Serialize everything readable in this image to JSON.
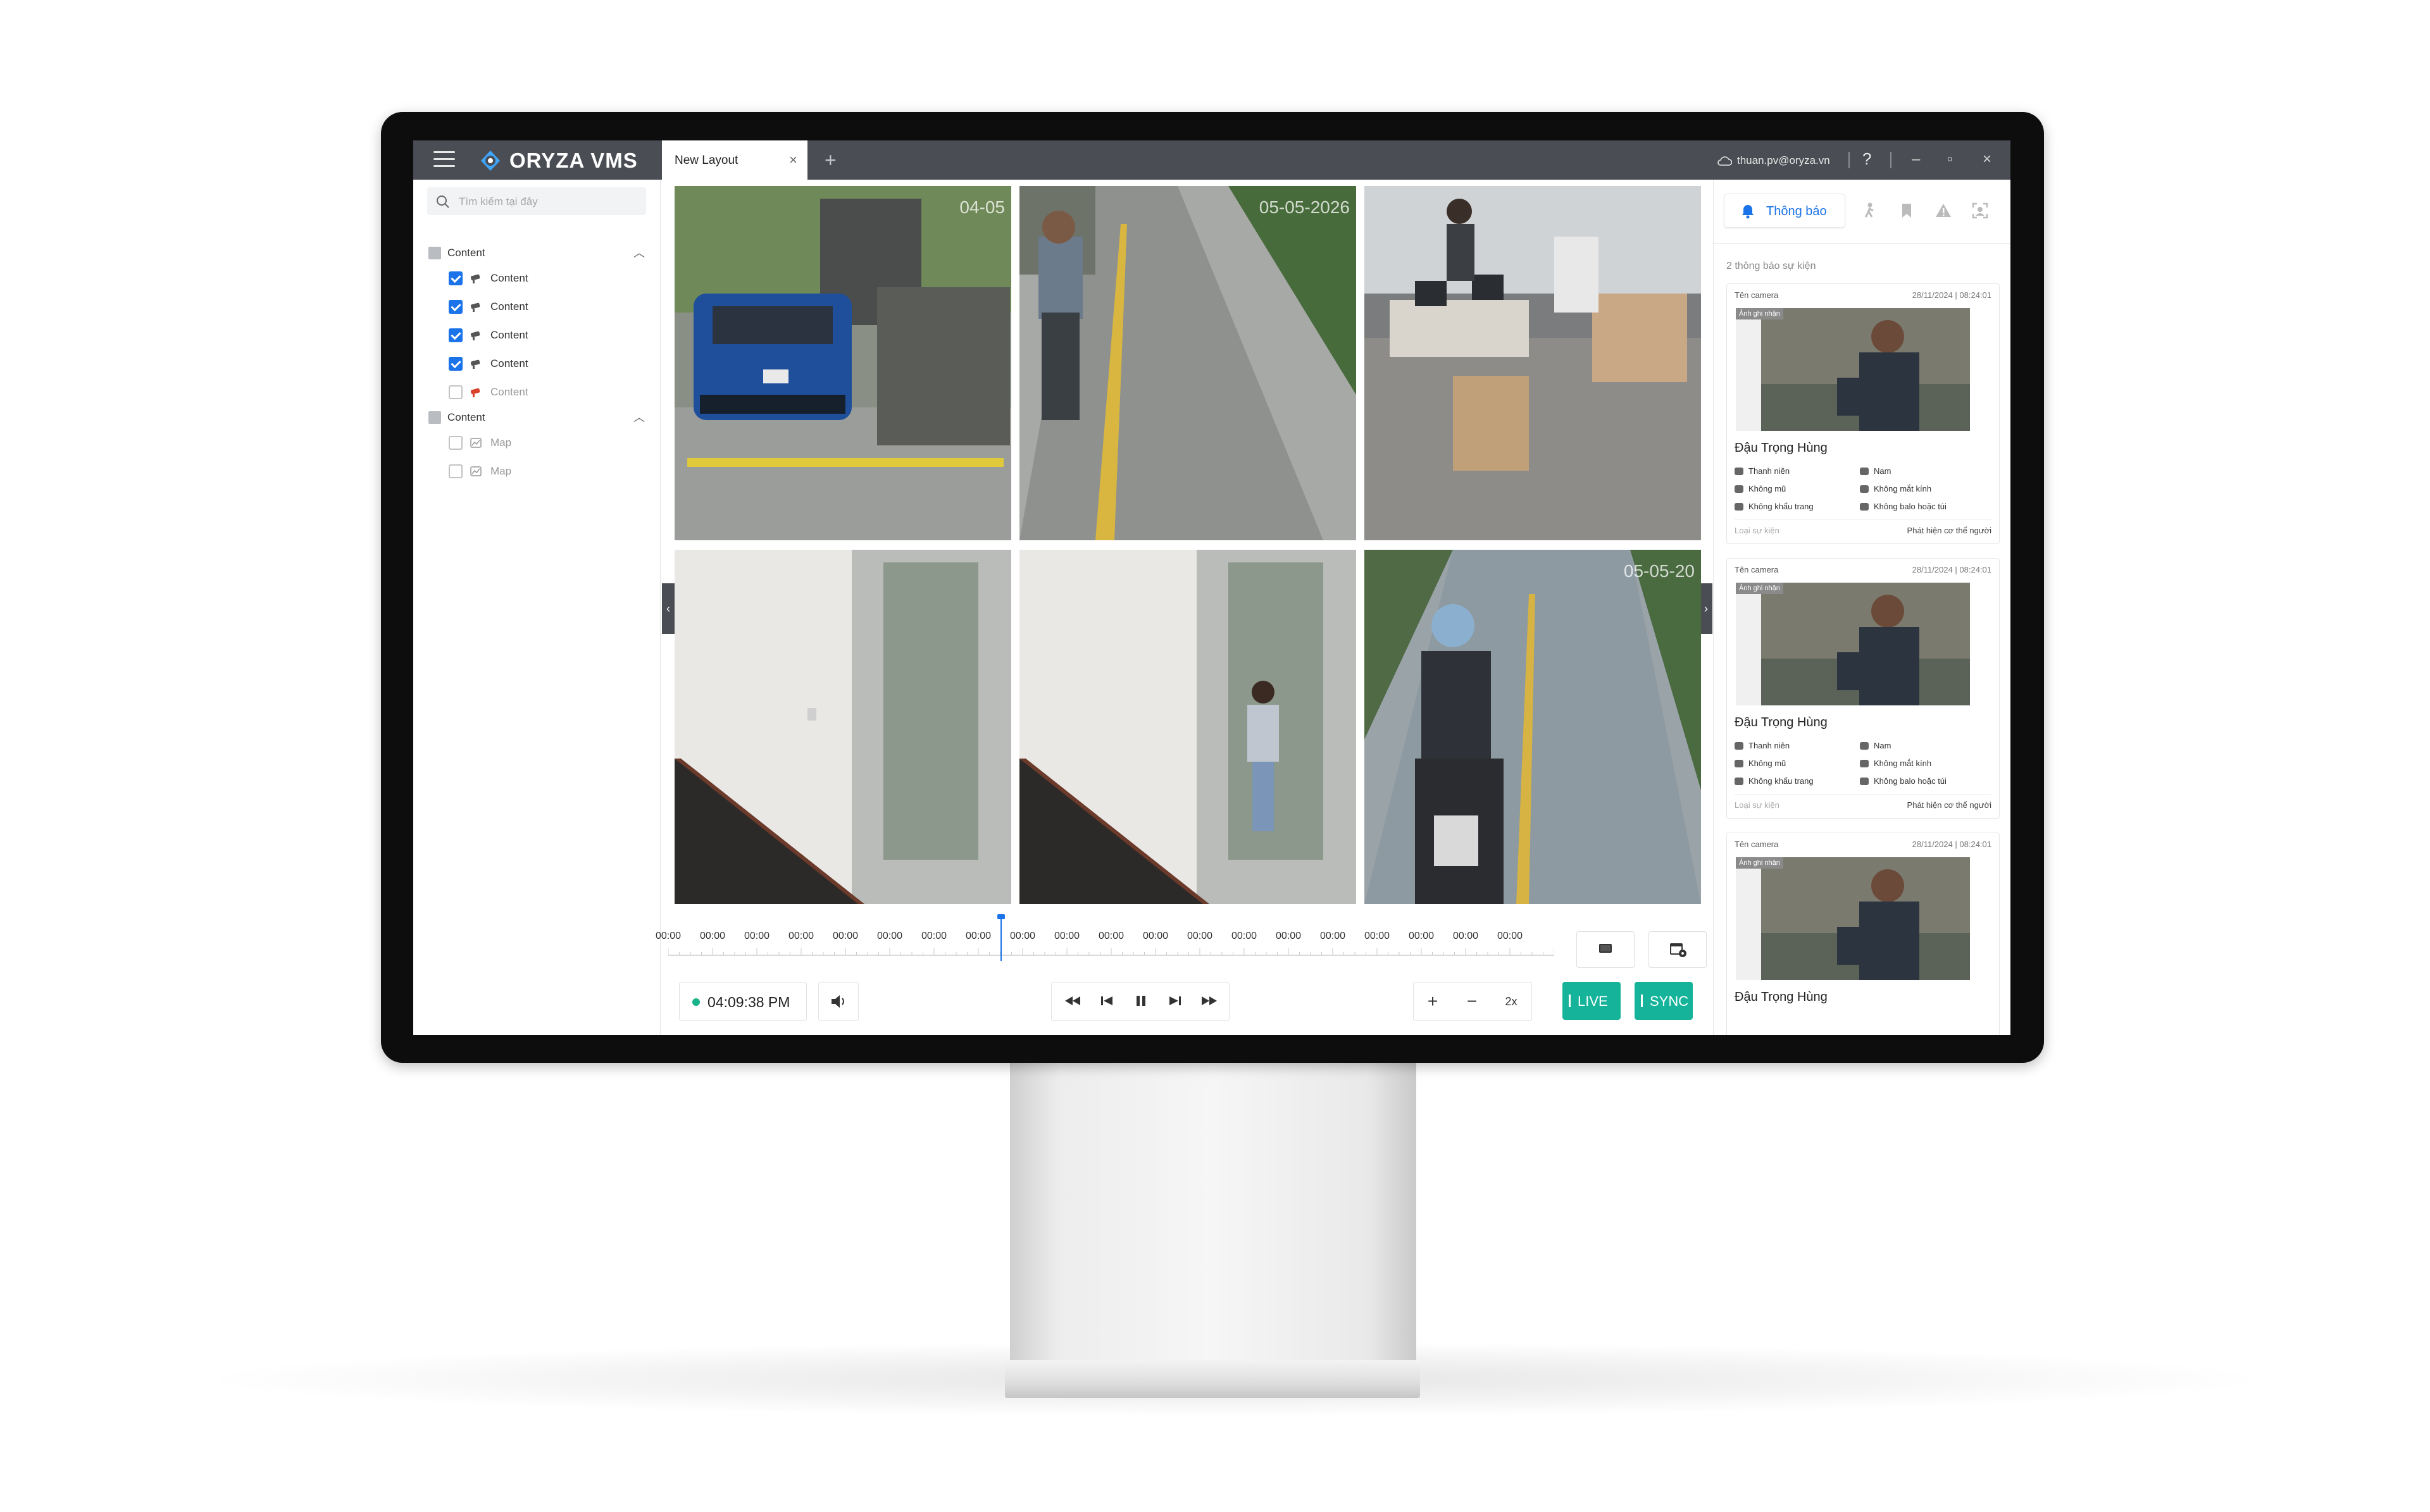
{
  "app": {
    "name": "ORYZA VMS",
    "tab_label": "New Layout",
    "tab_close": "×",
    "tab_add": "+",
    "account": "thuan.pv@oryza.vn",
    "help": "?",
    "win_min": "–",
    "win_max": "▫",
    "win_close": "×"
  },
  "sidebar": {
    "search_placeholder": "Tìm kiếm tại đây",
    "groups": [
      {
        "label": "Content",
        "items": [
          {
            "label": "Content",
            "checked": true
          },
          {
            "label": "Content",
            "checked": true
          },
          {
            "label": "Content",
            "checked": true
          },
          {
            "label": "Content",
            "checked": true
          },
          {
            "label": "Content",
            "checked": false
          }
        ]
      },
      {
        "label": "Content",
        "items": [
          {
            "label": "Map",
            "checked": false
          },
          {
            "label": "Map",
            "checked": false
          }
        ]
      }
    ]
  },
  "cameras": [
    {
      "timestamp": "04-05"
    },
    {
      "timestamp": "05-05-2026"
    },
    {
      "timestamp": ""
    },
    {
      "timestamp": ""
    },
    {
      "timestamp": ""
    },
    {
      "timestamp": "05-05-20"
    }
  ],
  "timeline": {
    "labels": [
      "00:00",
      "00:00",
      "00:00",
      "00:00",
      "00:00",
      "00:00",
      "00:00",
      "00:00",
      "00:00",
      "00:00",
      "00:00",
      "00:00",
      "00:00",
      "00:00",
      "00:00",
      "00:00",
      "00:00",
      "00:00",
      "00:00",
      "00:00"
    ],
    "cursor_position": 0.375
  },
  "controls": {
    "current_time": "04:09:38 PM",
    "zoom_in": "+",
    "zoom_out": "−",
    "speed": "2x",
    "live_label": "LIVE",
    "sync_label": "SYNC"
  },
  "notifications": {
    "tab_label": "Thông báo",
    "count_text": "2 thông báo sự kiện",
    "events": [
      {
        "camera_label": "Tên camera",
        "date": "28/11/2024",
        "time": "08:24:01",
        "badge": "Ảnh ghi nhận",
        "person": "Đậu Trọng Hùng",
        "attrs": [
          "Thanh niên",
          "Nam",
          "Không mũ",
          "Không mắt kính",
          "Không khẩu trang",
          "Không balo hoặc túi"
        ],
        "event_type_label": "Loại sự kiện",
        "event_type_value": "Phát hiện cơ thể người"
      },
      {
        "camera_label": "Tên camera",
        "date": "28/11/2024",
        "time": "08:24:01",
        "badge": "Ảnh ghi nhận",
        "person": "Đậu Trọng Hùng",
        "attrs": [
          "Thanh niên",
          "Nam",
          "Không mũ",
          "Không mắt kính",
          "Không khẩu trang",
          "Không balo hoặc túi"
        ],
        "event_type_label": "Loại sự kiện",
        "event_type_value": "Phát hiện cơ thể người"
      },
      {
        "camera_label": "Tên camera",
        "date": "28/11/2024",
        "time": "08:24:01",
        "badge": "Ảnh ghi nhận",
        "person": "Đậu Trọng Hùng"
      }
    ]
  },
  "colors": {
    "titlebar": "#4a4e54",
    "accent_blue": "#1a73e8",
    "live_green": "#14b39a",
    "status_dot": "#19b38a"
  }
}
